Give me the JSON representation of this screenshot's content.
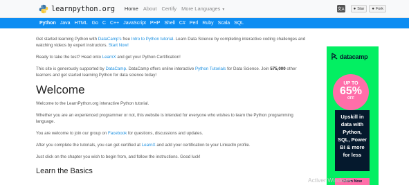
{
  "header": {
    "logo_text": "learnpython.org",
    "nav": [
      "Home",
      "About",
      "Certify",
      "More Languages"
    ],
    "lang_icon_text": "文A",
    "star_label": "Star",
    "fork_label": "Fork"
  },
  "langbar": {
    "items": [
      "Python",
      "Java",
      "HTML",
      "Go",
      "C",
      "C++",
      "JavaScript",
      "PHP",
      "Shell",
      "C#",
      "Perl",
      "Ruby",
      "Scala",
      "SQL"
    ]
  },
  "content": {
    "p1": {
      "t1": "Get started learning Python with ",
      "link1": "DataCamp's",
      "t2": " free ",
      "link2": "Intro to Python tutorial",
      "t3": ". Learn Data Science by completing interactive coding challenges and watching videos by expert instructors. ",
      "link3": "Start Now!"
    },
    "p2": {
      "t1": "Ready to take the test? Head onto ",
      "link1": "LearnX",
      "t2": " and get your Python Certification!"
    },
    "p3": {
      "t1": "This site is generously supported by ",
      "link1": "DataCamp",
      "t2": ". DataCamp offers online interactive ",
      "link2": "Python Tutorials",
      "t3": " for Data Science. Join ",
      "bold": "575,000",
      "t4": " other learners and get started learning Python for data science today!"
    },
    "welcome_heading": "Welcome",
    "p4": "Welcome to the LearnPython.org interactive Python tutorial.",
    "p5": "Whether you are an experienced programmer or not, this website is intended for everyone who wishes to learn the Python programming language.",
    "p6": {
      "t1": "You are welcome to join our group on ",
      "link1": "Facebook",
      "t2": " for questions, discussions and updates."
    },
    "p7": {
      "t1": "After you complete the tutorials, you can get certified at ",
      "link1": "LearnX",
      "t2": " and add your certification to your LinkedIn profile."
    },
    "p8": "Just click on the chapter you wish to begin from, and follow the instructions. Good luck!",
    "basics_heading": "Learn the Basics"
  },
  "ad": {
    "brand": "datacamp",
    "up_to": "UP TO",
    "percent": "65%",
    "off": "OFF",
    "lines": [
      "Upskill in",
      "data with",
      "Python,",
      "SQL, Power",
      "BI & more",
      "for less"
    ],
    "button": "Claim Now"
  },
  "watermark": "Activer Windows",
  "colors": {
    "accent": "#0d8df2",
    "link": "#1a8fe0",
    "ad_green": "#03ef62",
    "ad_pink": "#ff6ea9",
    "ad_navy": "#05192d"
  }
}
